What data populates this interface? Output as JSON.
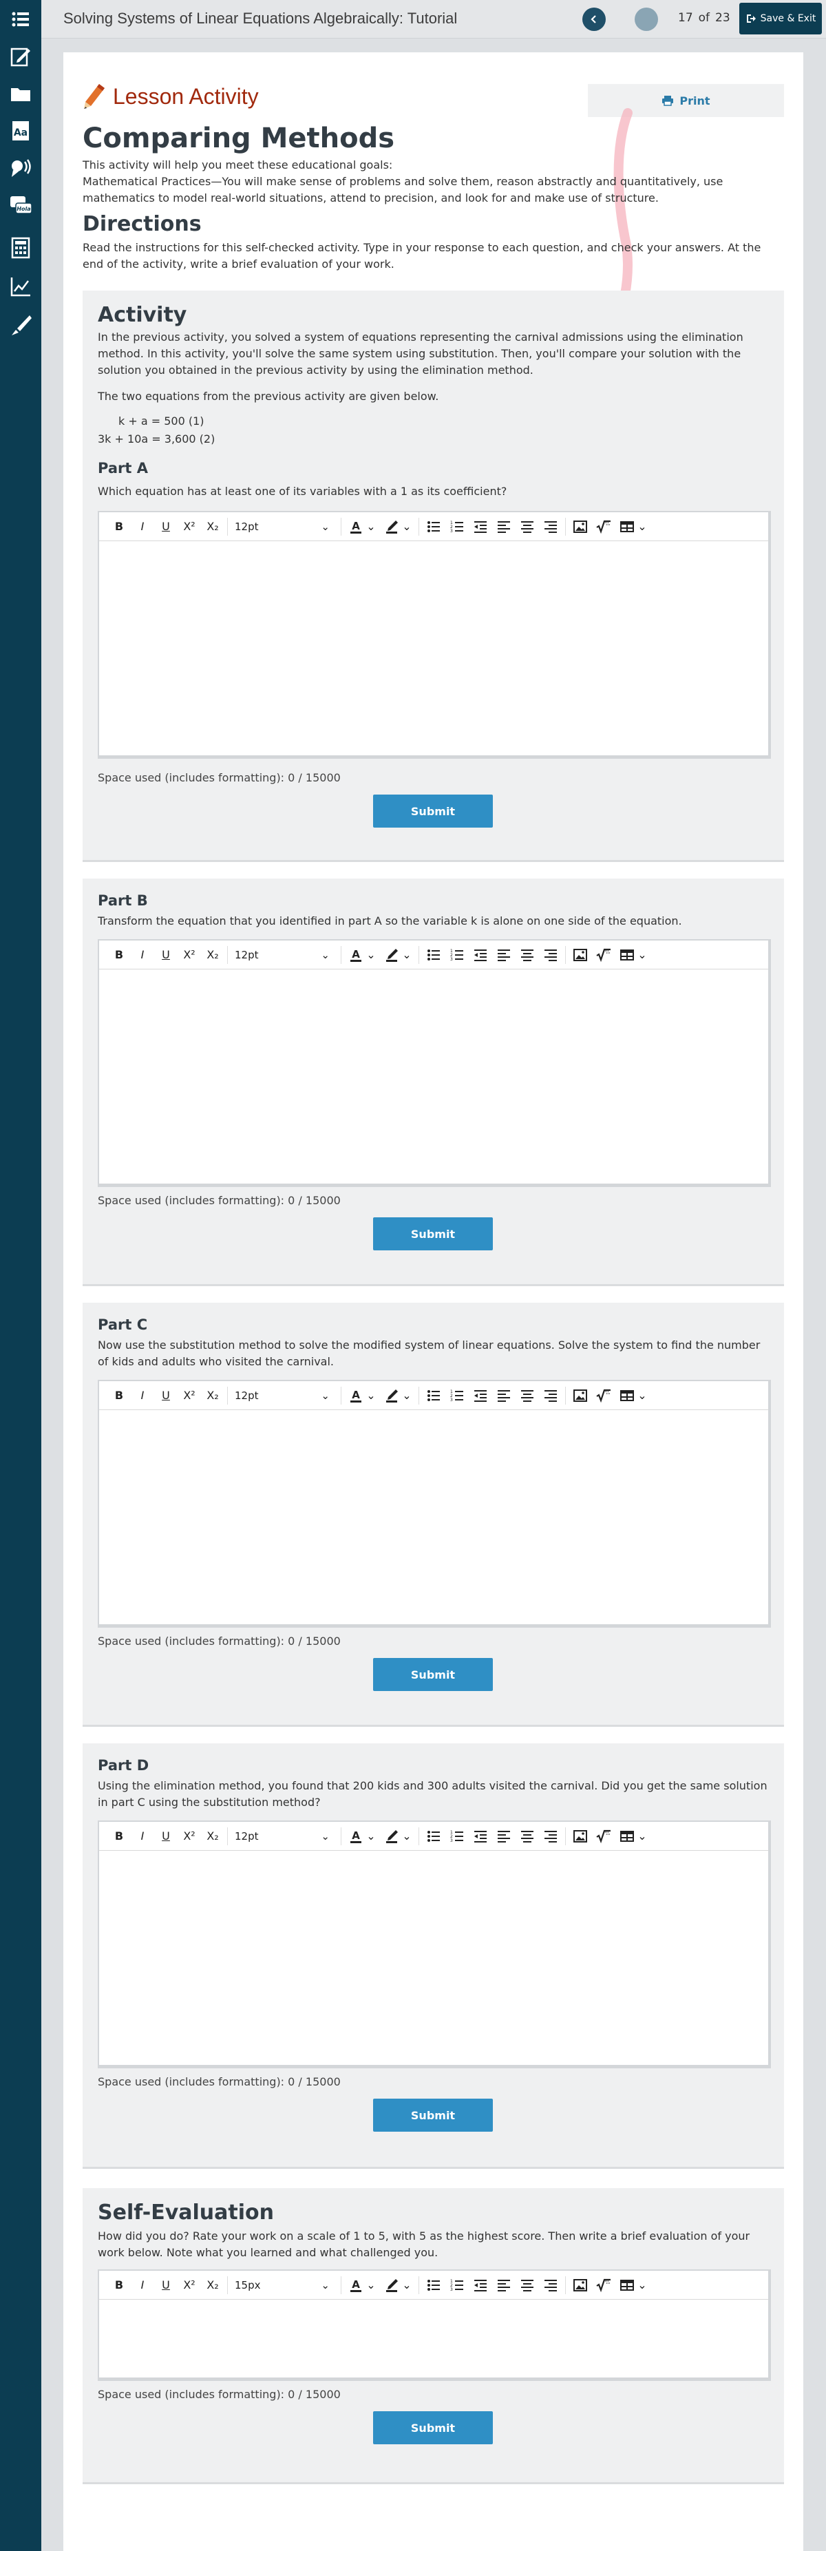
{
  "app": {
    "title": "Solving Systems of Linear Equations Algebraically: Tutorial",
    "page_current": "17",
    "page_of": "of",
    "page_total": "23",
    "save_exit_label": "Save & Exit"
  },
  "sidebar": {
    "items": [
      "list-icon",
      "edit-icon",
      "folder-icon",
      "dictionary-icon",
      "text-to-speech-icon",
      "translate-icon",
      "calculator-icon",
      "graph-icon",
      "highlighter-icon"
    ],
    "translate_badge": "Hola"
  },
  "lesson": {
    "header": "Lesson Activity",
    "print_label": "Print",
    "title": "Comparing Methods",
    "goals_intro": "This activity will help you meet these educational goals:",
    "goals_text": "Mathematical Practices—You will make sense of problems and solve them, reason abstractly and quantitatively, use mathematics to model real-world situations, attend to precision, and look for and make use of structure.",
    "directions_title": "Directions",
    "directions_text": "Read the instructions for this self-checked activity. Type in your response to each question, and check your answers. At the end of the activity, write a brief evaluation of your work."
  },
  "activity": {
    "title": "Activity",
    "intro": "In the previous activity, you solved a system of equations representing the carnival admissions using the elimination method. In this activity, you'll solve the same system using substitution. Then, you'll compare your solution with the solution you obtained in the previous activity by using the elimination method.",
    "eq_intro": "The two equations from the previous activity are given below.",
    "eq1": "k + a = 500 (1)",
    "eq2": "3k + 10a = 3,600 (2)"
  },
  "editor": {
    "bold": "B",
    "italic": "I",
    "underline": "U",
    "superscript": "X²",
    "subscript": "X₂",
    "font_color": "A"
  },
  "parts": [
    {
      "title": "Part A",
      "text": "Which equation has at least one of its variables with a 1 as its coefficient?",
      "font_size": "12pt",
      "space_used": "Space used (includes formatting): 0 / 15000",
      "submit": "Submit"
    },
    {
      "title": "Part B",
      "text": "Transform the equation that you identified in part A so the variable k is alone on one side of the equation.",
      "font_size": "12pt",
      "space_used": "Space used (includes formatting): 0 / 15000",
      "submit": "Submit"
    },
    {
      "title": "Part C",
      "text": "Now use the substitution method to solve the modified system of linear equations. Solve the system to find the number of kids and adults who visited the carnival.",
      "font_size": "12pt",
      "space_used": "Space used (includes formatting): 0 / 15000",
      "submit": "Submit"
    },
    {
      "title": "Part D",
      "text": "Using the elimination method, you found that 200 kids and 300 adults visited the carnival. Did you get the same solution in part C using the substitution method?",
      "font_size": "12pt",
      "space_used": "Space used (includes formatting): 0 / 15000",
      "submit": "Submit"
    }
  ],
  "self_eval": {
    "title": "Self-Evaluation",
    "text": "How did you do? Rate your work on a scale of 1 to 5, with 5 as the highest score. Then write a brief evaluation of your work below. Note what you learned and what challenged you.",
    "font_size": "15px",
    "space_used": "Space used (includes formatting): 0 / 15000",
    "submit": "Submit"
  },
  "colors": {
    "sidebar": "#0c3d52",
    "lesson_header": "#a1290d",
    "submit": "#2f8fc5",
    "print": "#2b7ba8"
  }
}
